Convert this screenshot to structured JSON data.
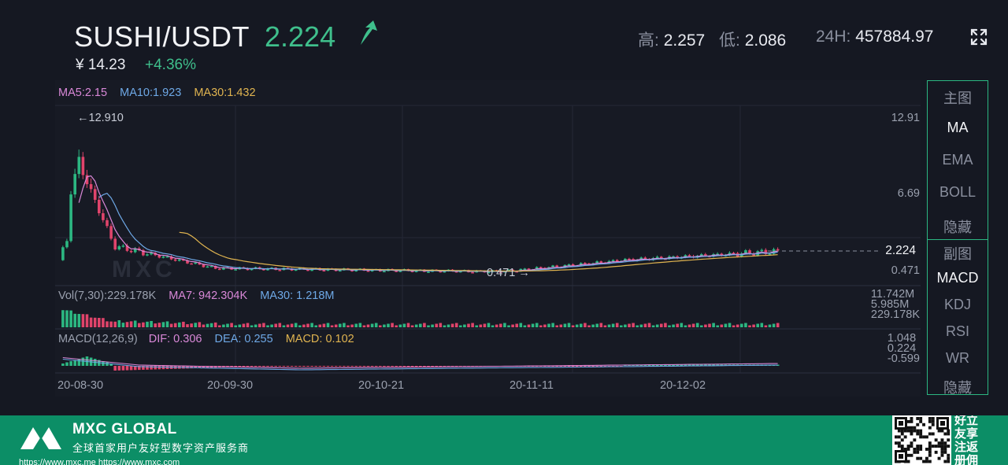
{
  "header": {
    "pair": "SUSHI/USDT",
    "price": "2.224",
    "cny_price": "¥ 14.23",
    "change": "+4.36%",
    "high_label": "高:",
    "high": "2.257",
    "low_label": "低:",
    "low": "2.086",
    "vol_label": "24H:",
    "vol": "457884.97"
  },
  "colors": {
    "up": "#2cb782",
    "down": "#e0446b",
    "ma5": "#d988d8",
    "ma10": "#6ea8e6",
    "ma30": "#e0b450",
    "accent": "#2cb782"
  },
  "main_chart": {
    "legend": {
      "ma5": "MA5:2.15",
      "ma10": "MA10:1.923",
      "ma30": "MA30:1.432"
    },
    "max_marker": "12.910",
    "min_marker": "0.471",
    "y_axis": [
      "12.91",
      "6.69",
      "0.471"
    ],
    "last_price": "2.224",
    "watermark": "MXC"
  },
  "volume": {
    "legend": {
      "title": "Vol(7,30):229.178K",
      "ma7": "MA7: 942.304K",
      "ma30": "MA30: 1.218M"
    },
    "y_axis": [
      "11.742M",
      "5.985M",
      "229.178K"
    ]
  },
  "macd": {
    "legend": {
      "title": "MACD(12,26,9)",
      "dif": "DIF: 0.306",
      "dea": "DEA: 0.255",
      "macd": "MACD: 0.102"
    },
    "y_axis": [
      "1.048",
      "0.224",
      "-0.599"
    ]
  },
  "x_axis": [
    "20-08-30",
    "20-09-30",
    "20-10-21",
    "20-11-11",
    "20-12-02"
  ],
  "side_panel": {
    "main_header": "主图",
    "main_items": [
      "MA",
      "EMA",
      "BOLL",
      "隐藏"
    ],
    "sub_header": "副图",
    "sub_items": [
      "MACD",
      "KDJ",
      "RSI",
      "WR",
      "隐藏"
    ],
    "active_main": "MA",
    "active_sub": "MACD"
  },
  "footer": {
    "brand": "MXC GLOBAL",
    "tagline": "全球首家用户友好型数字资产服务商",
    "urls": "https://www.mxc.me    https://www.mxc.com",
    "register": "好立友享注返册佣"
  }
}
